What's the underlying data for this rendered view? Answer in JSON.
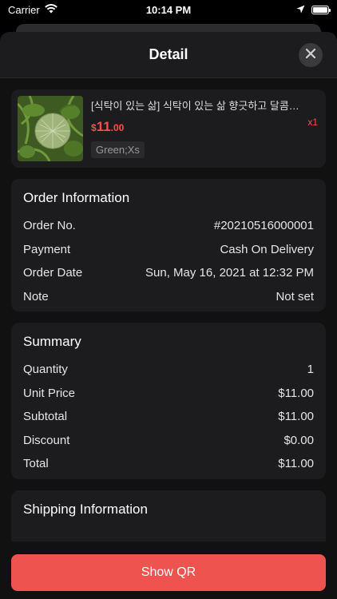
{
  "status_bar": {
    "carrier": "Carrier",
    "time": "10:14 PM"
  },
  "header": {
    "title": "Detail"
  },
  "product": {
    "name": "[식탁이 있는 삶] 식탁이 있는 삶 향긋하고 달콤한 성…",
    "price_currency": "$",
    "price_int": "11",
    "price_dec": ".00",
    "variant": "Green;Xs",
    "quantity_badge": "x1"
  },
  "order_info": {
    "title": "Order Information",
    "rows": [
      {
        "label": "Order No.",
        "value": "#20210516000001"
      },
      {
        "label": "Payment",
        "value": "Cash On Delivery"
      },
      {
        "label": "Order Date",
        "value": "Sun, May 16, 2021 at 12:32 PM"
      },
      {
        "label": "Note",
        "value": "Not set"
      }
    ]
  },
  "summary": {
    "title": "Summary",
    "rows": [
      {
        "label": "Quantity",
        "value": "1"
      },
      {
        "label": "Unit Price",
        "value": "$11.00"
      },
      {
        "label": "Subtotal",
        "value": "$11.00"
      },
      {
        "label": "Discount",
        "value": "$0.00"
      },
      {
        "label": "Total",
        "value": "$11.00"
      }
    ]
  },
  "shipping": {
    "title": "Shipping Information"
  },
  "footer": {
    "show_qr_label": "Show QR"
  },
  "colors": {
    "accent": "#ef5350",
    "price": "#ff4d4f"
  }
}
